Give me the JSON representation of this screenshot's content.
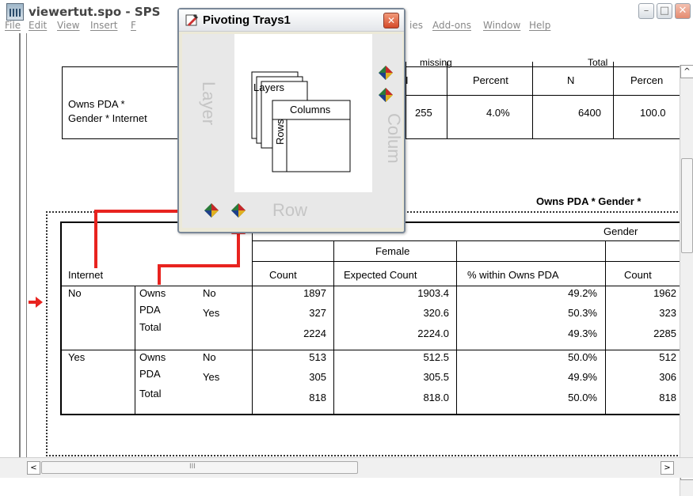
{
  "window": {
    "title": "viewertut.spo - SPS",
    "min_glyph": "–",
    "max_glyph": "□",
    "close_glyph": "✕"
  },
  "menu": {
    "file": "File",
    "edit": "Edit",
    "view": "View",
    "insert": "Insert",
    "insert_trunc": "F",
    "ies": "ies",
    "addons": "Add-ons",
    "window": "Window",
    "help": "Help"
  },
  "pivot": {
    "title": "Pivoting Trays1",
    "close_glyph": "✕",
    "layer_label": "Layer",
    "column_label": "Colum",
    "row_label": "Row",
    "diagram_layers": "Layers",
    "diagram_columns": "Columns",
    "diagram_rows": "Rows"
  },
  "upper_table": {
    "header_missing": "missing",
    "header_total": "Total",
    "col_percent": "Percent",
    "col_n": "N",
    "col_percent2": "Percen",
    "row_label_1": "Owns PDA *",
    "row_label_2": "Gender * Internet",
    "missing_n": "255",
    "missing_pct": "4.0%",
    "total_n": "6400",
    "total_pct": "100.0"
  },
  "main_table": {
    "title": "Owns PDA * Gender *",
    "gender": "Gender",
    "female": "Female",
    "internet": "Internet",
    "col_count": "Count",
    "col_expected": "Expected Count",
    "col_within": "% within Owns PDA",
    "col_count2": "Count",
    "owns": "Owns",
    "pda": "PDA",
    "total": "Total",
    "no": "No",
    "yes": "Yes",
    "rows": [
      [
        "No",
        "No",
        "1897",
        "1903.4",
        "49.2%",
        "1962"
      ],
      [
        "",
        "Yes",
        "327",
        "320.6",
        "50.3%",
        "323"
      ],
      [
        "",
        "Total",
        "2224",
        "2224.0",
        "49.3%",
        "2285"
      ],
      [
        "Yes",
        "No",
        "513",
        "512.5",
        "50.0%",
        "512"
      ],
      [
        "",
        "Yes",
        "305",
        "305.5",
        "49.9%",
        "306"
      ],
      [
        "",
        "Total",
        "818",
        "818.0",
        "50.0%",
        "818"
      ]
    ]
  },
  "scroll": {
    "left_glyph": "<",
    "right_glyph": ">",
    "up_glyph": "^",
    "down_glyph": "v",
    "grip_glyph": "III"
  },
  "colors": {
    "arrow_red": "#e8231f",
    "title_bar": "#ffffff"
  }
}
